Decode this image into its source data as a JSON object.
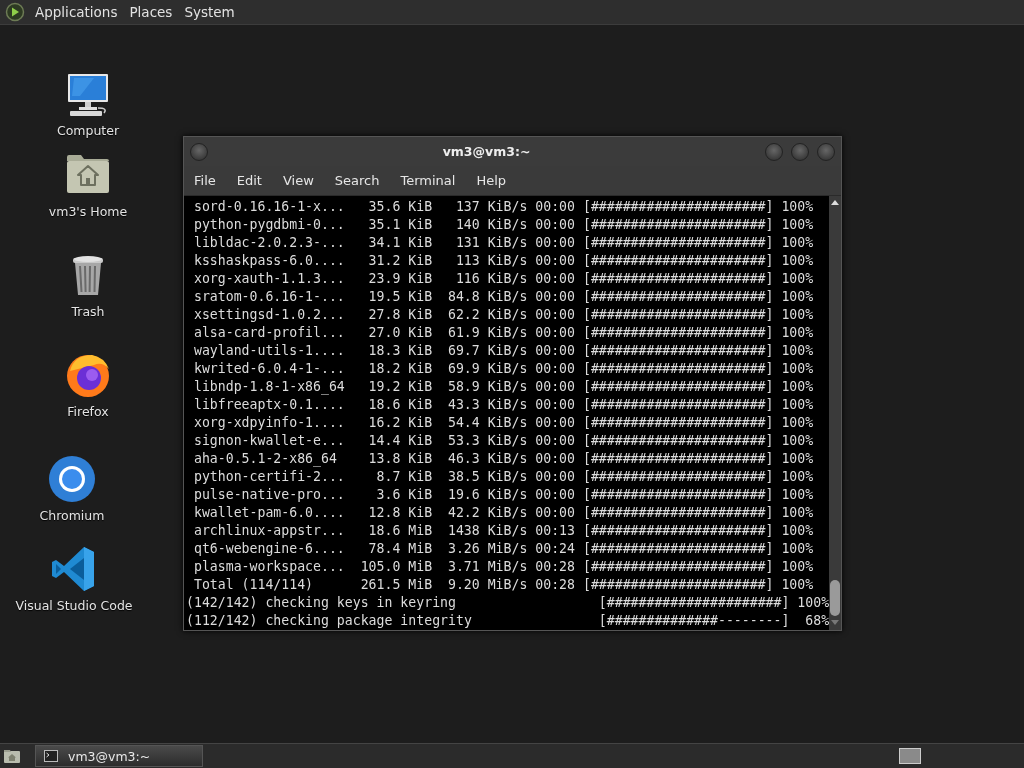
{
  "top_panel": {
    "menus": [
      "Applications",
      "Places",
      "System"
    ]
  },
  "desktop_icons": [
    {
      "kind": "computer",
      "label": "Computer"
    },
    {
      "kind": "home",
      "label": "vm3's Home"
    },
    {
      "kind": "trash",
      "label": "Trash"
    },
    {
      "kind": "firefox",
      "label": "Firefox"
    },
    {
      "kind": "chromium",
      "label": "Chromium"
    },
    {
      "kind": "vscode",
      "label": "Visual Studio Code"
    }
  ],
  "terminal": {
    "title": "vm3@vm3:~",
    "menu": [
      "File",
      "Edit",
      "View",
      "Search",
      "Terminal",
      "Help"
    ],
    "rows": [
      {
        "kind": "download",
        "name": "sord-0.16.16-1-x...",
        "size": "35.6 KiB",
        "rate": "137 KiB/s",
        "eta": "00:00",
        "bar": "[######################]",
        "percent": "100%"
      },
      {
        "kind": "download",
        "name": "python-pygdbmi-0...",
        "size": "35.1 KiB",
        "rate": "140 KiB/s",
        "eta": "00:00",
        "bar": "[######################]",
        "percent": "100%"
      },
      {
        "kind": "download",
        "name": "libldac-2.0.2.3-...",
        "size": "34.1 KiB",
        "rate": "131 KiB/s",
        "eta": "00:00",
        "bar": "[######################]",
        "percent": "100%"
      },
      {
        "kind": "download",
        "name": "ksshaskpass-6.0....",
        "size": "31.2 KiB",
        "rate": "113 KiB/s",
        "eta": "00:00",
        "bar": "[######################]",
        "percent": "100%"
      },
      {
        "kind": "download",
        "name": "xorg-xauth-1.1.3...",
        "size": "23.9 KiB",
        "rate": "116 KiB/s",
        "eta": "00:00",
        "bar": "[######################]",
        "percent": "100%"
      },
      {
        "kind": "download",
        "name": "sratom-0.6.16-1-...",
        "size": "19.5 KiB",
        "rate": "84.8 KiB/s",
        "eta": "00:00",
        "bar": "[######################]",
        "percent": "100%"
      },
      {
        "kind": "download",
        "name": "xsettingsd-1.0.2...",
        "size": "27.8 KiB",
        "rate": "62.2 KiB/s",
        "eta": "00:00",
        "bar": "[######################]",
        "percent": "100%"
      },
      {
        "kind": "download",
        "name": "alsa-card-profil...",
        "size": "27.0 KiB",
        "rate": "61.9 KiB/s",
        "eta": "00:00",
        "bar": "[######################]",
        "percent": "100%"
      },
      {
        "kind": "download",
        "name": "wayland-utils-1....",
        "size": "18.3 KiB",
        "rate": "69.7 KiB/s",
        "eta": "00:00",
        "bar": "[######################]",
        "percent": "100%"
      },
      {
        "kind": "download",
        "name": "kwrited-6.0.4-1-...",
        "size": "18.2 KiB",
        "rate": "69.9 KiB/s",
        "eta": "00:00",
        "bar": "[######################]",
        "percent": "100%"
      },
      {
        "kind": "download",
        "name": "libndp-1.8-1-x86_64",
        "size": "19.2 KiB",
        "rate": "58.9 KiB/s",
        "eta": "00:00",
        "bar": "[######################]",
        "percent": "100%"
      },
      {
        "kind": "download",
        "name": "libfreeaptx-0.1....",
        "size": "18.6 KiB",
        "rate": "43.3 KiB/s",
        "eta": "00:00",
        "bar": "[######################]",
        "percent": "100%"
      },
      {
        "kind": "download",
        "name": "xorg-xdpyinfo-1....",
        "size": "16.2 KiB",
        "rate": "54.4 KiB/s",
        "eta": "00:00",
        "bar": "[######################]",
        "percent": "100%"
      },
      {
        "kind": "download",
        "name": "signon-kwallet-e...",
        "size": "14.4 KiB",
        "rate": "53.3 KiB/s",
        "eta": "00:00",
        "bar": "[######################]",
        "percent": "100%"
      },
      {
        "kind": "download",
        "name": "aha-0.5.1-2-x86_64",
        "size": "13.8 KiB",
        "rate": "46.3 KiB/s",
        "eta": "00:00",
        "bar": "[######################]",
        "percent": "100%"
      },
      {
        "kind": "download",
        "name": "python-certifi-2...",
        "size": "8.7 KiB",
        "rate": "38.5 KiB/s",
        "eta": "00:00",
        "bar": "[######################]",
        "percent": "100%"
      },
      {
        "kind": "download",
        "name": "pulse-native-pro...",
        "size": "3.6 KiB",
        "rate": "19.6 KiB/s",
        "eta": "00:00",
        "bar": "[######################]",
        "percent": "100%"
      },
      {
        "kind": "download",
        "name": "kwallet-pam-6.0....",
        "size": "12.8 KiB",
        "rate": "42.2 KiB/s",
        "eta": "00:00",
        "bar": "[######################]",
        "percent": "100%"
      },
      {
        "kind": "download",
        "name": "archlinux-appstr...",
        "size": "18.6 MiB",
        "rate": "1438 KiB/s",
        "eta": "00:13",
        "bar": "[######################]",
        "percent": "100%"
      },
      {
        "kind": "download",
        "name": "qt6-webengine-6....",
        "size": "78.4 MiB",
        "rate": "3.26 MiB/s",
        "eta": "00:24",
        "bar": "[######################]",
        "percent": "100%"
      },
      {
        "kind": "download",
        "name": "plasma-workspace...",
        "size": "105.0 MiB",
        "rate": "3.71 MiB/s",
        "eta": "00:28",
        "bar": "[######################]",
        "percent": "100%"
      },
      {
        "kind": "download",
        "name": "Total (114/114)",
        "size": "261.5 MiB",
        "rate": "9.20 MiB/s",
        "eta": "00:28",
        "bar": "[######################]",
        "percent": "100%"
      },
      {
        "kind": "step",
        "text": "(142/142) checking keys in keyring",
        "bar": "[######################]",
        "percent": "100%"
      },
      {
        "kind": "step",
        "text": "(112/142) checking package integrity",
        "bar": "[##############--------]",
        "percent": "68%"
      }
    ]
  },
  "taskbar": {
    "tasks": [
      {
        "label": "vm3@vm3:~"
      }
    ]
  }
}
